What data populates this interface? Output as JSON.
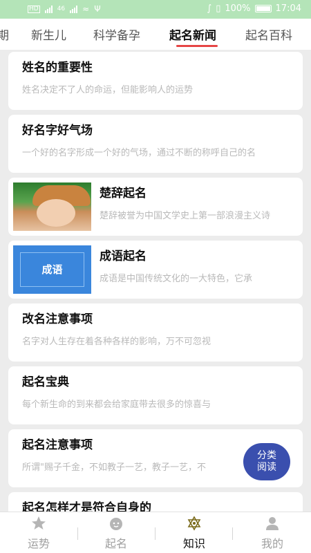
{
  "status_bar": {
    "signal_label": "46",
    "battery": "100%",
    "time": "17:04"
  },
  "tabs": [
    {
      "label": "期"
    },
    {
      "label": "新生儿"
    },
    {
      "label": "科学备孕"
    },
    {
      "label": "起名新闻"
    },
    {
      "label": "起名百科"
    }
  ],
  "active_tab": "起名新闻",
  "articles": [
    {
      "title": "姓名的重要性",
      "desc": "姓名决定不了人的命运，但能影响人的运势"
    },
    {
      "title": "好名字好气场",
      "desc": "一个好的名字形成一个好的气场，通过不断的称呼自己的名"
    },
    {
      "title": "楚辞起名",
      "desc": "楚辞被誉为中国文学史上第一部浪漫主义诗"
    },
    {
      "title": "成语起名",
      "desc": "成语是中国传统文化的一大特色，它承",
      "thumb_text": "成语"
    },
    {
      "title": "改名注意事项",
      "desc": "名字对人生存在着各种各样的影响，万不可忽视"
    },
    {
      "title": "起名宝典",
      "desc": "每个新生命的到来都会给家庭带去很多的惊喜与"
    },
    {
      "title": "起名注意事项",
      "desc": "所谓\"赐子千金，不如教子一艺，教子一艺，不"
    },
    {
      "title": "起名怎样才是符合自身的",
      "desc": ""
    }
  ],
  "float_button": {
    "line1": "分类",
    "line2": "阅读"
  },
  "bottom_nav": [
    {
      "label": "运势",
      "icon": "star-icon"
    },
    {
      "label": "起名",
      "icon": "baby-face-icon"
    },
    {
      "label": "知识",
      "icon": "hexagram-icon"
    },
    {
      "label": "我的",
      "icon": "user-icon"
    }
  ],
  "colors": {
    "status_bar": "#b4e4b8",
    "tab_indicator": "#e64545",
    "float_button": "#3a4fae",
    "active_nav_icon": "#7a6a1a"
  }
}
